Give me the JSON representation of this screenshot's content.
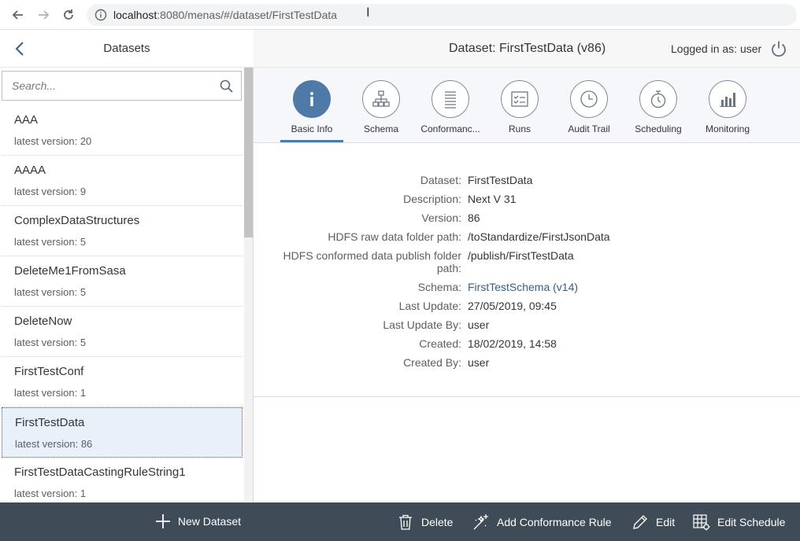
{
  "browser": {
    "url_host": "localhost",
    "url_rest": ":8080/menas/#/dataset/FirstTestData"
  },
  "left": {
    "title": "Datasets",
    "search_placeholder": "Search...",
    "items": [
      {
        "name": "AAA",
        "version": "latest version: 20"
      },
      {
        "name": "AAAA",
        "version": "latest version: 9"
      },
      {
        "name": "ComplexDataStructures",
        "version": "latest version: 5"
      },
      {
        "name": "DeleteMe1FromSasa",
        "version": "latest version: 5"
      },
      {
        "name": "DeleteNow",
        "version": "latest version: 5"
      },
      {
        "name": "FirstTestConf",
        "version": "latest version: 1"
      },
      {
        "name": "FirstTestData",
        "version": "latest version: 86"
      },
      {
        "name": "FirstTestDataCastingRuleString1",
        "version": "latest version: 1"
      }
    ],
    "new_dataset_label": "New Dataset"
  },
  "header": {
    "title": "Dataset: FirstTestData (v86)",
    "logged_in": "Logged in as: user"
  },
  "tabs": [
    {
      "label": "Basic Info",
      "icon": "info-icon"
    },
    {
      "label": "Schema",
      "icon": "hierarchy-icon"
    },
    {
      "label": "Conformanc...",
      "icon": "list-icon"
    },
    {
      "label": "Runs",
      "icon": "checklist-icon"
    },
    {
      "label": "Audit Trail",
      "icon": "clock-icon"
    },
    {
      "label": "Scheduling",
      "icon": "stopwatch-icon"
    },
    {
      "label": "Monitoring",
      "icon": "bar-chart-icon"
    }
  ],
  "details": {
    "dataset_label": "Dataset:",
    "dataset": "FirstTestData",
    "description_label": "Description:",
    "description": "Next V 31",
    "version_label": "Version:",
    "version": "86",
    "raw_label": "HDFS raw data folder path:",
    "raw": "/toStandardize/FirstJsonData",
    "conformed_label_1": "HDFS conformed data publish folder",
    "conformed_label_2": "path:",
    "conformed": "/publish/FirstTestData",
    "schema_label": "Schema:",
    "schema": "FirstTestSchema (v14)",
    "last_update_label": "Last Update:",
    "last_update": "27/05/2019, 09:45",
    "last_update_by_label": "Last Update By:",
    "last_update_by": "user",
    "created_label": "Created:",
    "created": "18/02/2019, 14:58",
    "created_by_label": "Created By:",
    "created_by": "user"
  },
  "footer": {
    "delete": "Delete",
    "add_rule": "Add Conformance Rule",
    "edit": "Edit",
    "edit_schedule": "Edit Schedule"
  }
}
